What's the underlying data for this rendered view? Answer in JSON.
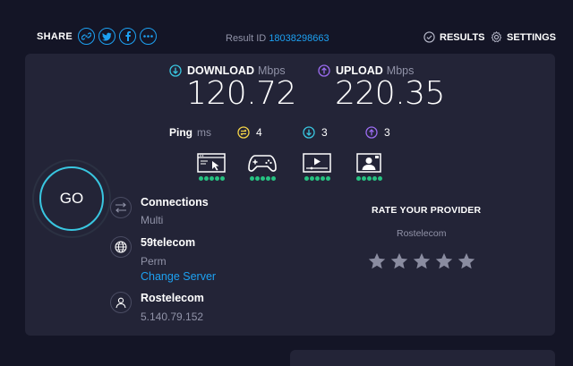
{
  "header": {
    "share_label": "SHARE",
    "result_id_label": "Result ID",
    "result_id_value": "18038298663",
    "results_label": "RESULTS",
    "settings_label": "SETTINGS"
  },
  "speeds": {
    "download_label": "DOWNLOAD",
    "download_unit": "Mbps",
    "download_value": "120.72",
    "upload_label": "UPLOAD",
    "upload_unit": "Mbps",
    "upload_value": "220.35"
  },
  "ping": {
    "label": "Ping",
    "unit": "ms",
    "idle": "4",
    "download": "3",
    "upload": "3"
  },
  "go_label": "GO",
  "connection": {
    "connections_title": "Connections",
    "connections_mode": "Multi",
    "server_name": "59telecom",
    "server_location": "Perm",
    "change_server_label": "Change Server",
    "isp_name": "Rostelecom",
    "isp_ip": "5.140.79.152"
  },
  "rating": {
    "title": "RATE YOUR PROVIDER",
    "provider": "Rostelecom",
    "stars_max": 5,
    "stars_filled": 0
  },
  "colors": {
    "accent_blue": "#1da1f2",
    "download": "#39c6e0",
    "upload": "#9b6cf0",
    "ping_idle": "#f5d547",
    "dots_green": "#26c281"
  }
}
